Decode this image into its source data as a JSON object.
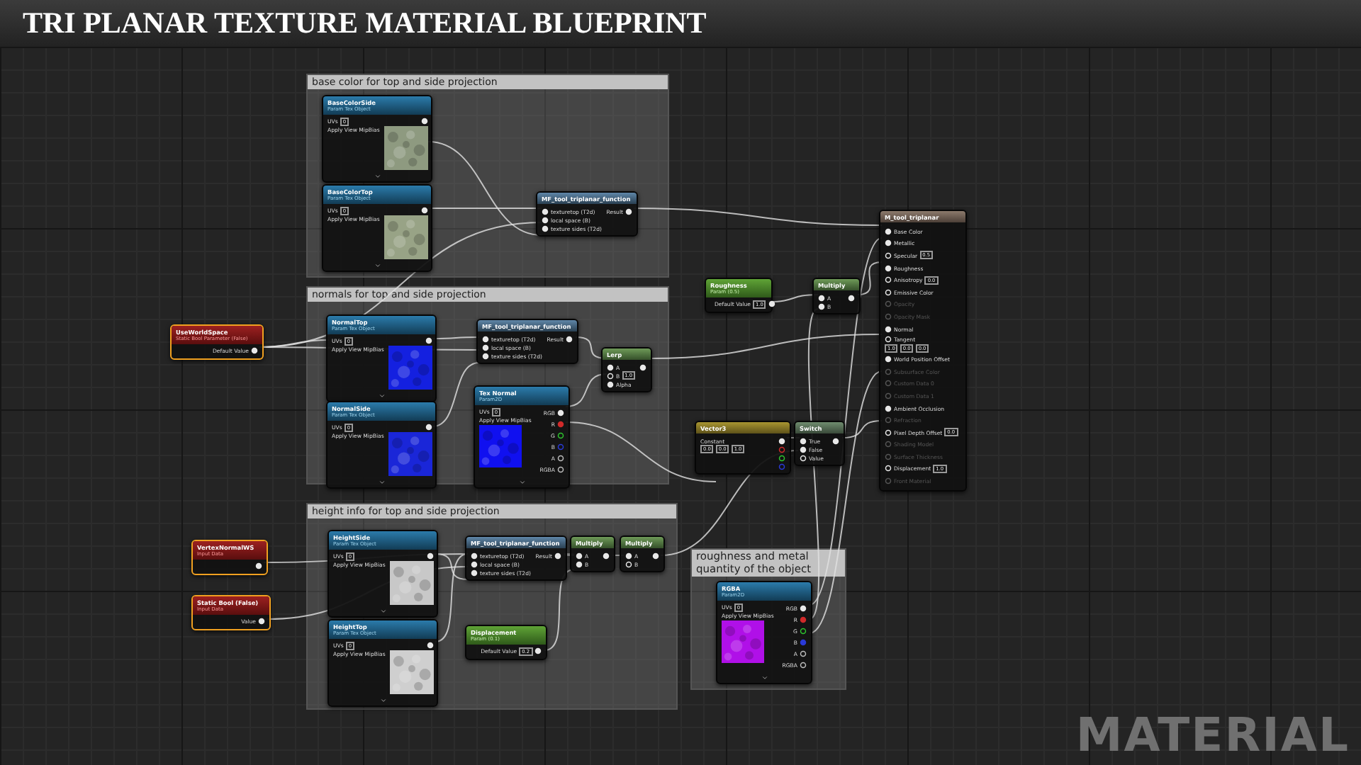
{
  "title": "TRI PLANAR TEXTURE MATERIAL BLUEPRINT",
  "comments": [
    {
      "text": "base color for top and side projection"
    },
    {
      "text": "normals for top and side projection"
    },
    {
      "text": "height info for top and side projection"
    },
    {
      "text": "roughness and metal quantity of the object"
    }
  ],
  "nodes": [
    {
      "kind": "texture_param",
      "title": "BaseColorSide",
      "subtitle": "Param Tex Object",
      "selected": false,
      "color": "#8e9a80",
      "fields": [
        {
          "label": "UVs",
          "value": "0"
        },
        {
          "label": "Apply View MipBias"
        }
      ],
      "outputs": [
        {
          "connected": true
        }
      ]
    },
    {
      "kind": "texture_param",
      "title": "BaseColorTop",
      "subtitle": "Param Tex Object",
      "selected": false,
      "color": "#98a386",
      "fields": [
        {
          "label": "UVs",
          "value": "0"
        },
        {
          "label": "Apply View MipBias"
        }
      ],
      "outputs": [
        {
          "connected": true
        }
      ]
    },
    {
      "kind": "function",
      "title": "MF_tool_triplanar_function",
      "selected": false,
      "inputs": [
        {
          "label": "texturetop (T2d)",
          "connected": true
        },
        {
          "label": "local space (B)",
          "connected": true
        },
        {
          "label": "texture sides (T2d)",
          "connected": true
        }
      ],
      "outputs": [
        {
          "label": "Result",
          "connected": true
        }
      ]
    },
    {
      "kind": "texture_param",
      "title": "NormalTop",
      "subtitle": "Param Tex Object",
      "selected": false,
      "color": "#1420e0",
      "fields": [
        {
          "label": "UVs",
          "value": "0"
        },
        {
          "label": "Apply View MipBias"
        }
      ],
      "outputs": [
        {
          "connected": true
        }
      ]
    },
    {
      "kind": "texture_param",
      "title": "NormalSide",
      "subtitle": "Param Tex Object",
      "selected": false,
      "color": "#1a26d8",
      "fields": [
        {
          "label": "UVs",
          "value": "0"
        },
        {
          "label": "Apply View MipBias"
        }
      ],
      "outputs": [
        {
          "connected": true
        }
      ]
    },
    {
      "kind": "bool_param",
      "title": "UseWorldSpace",
      "subtitle": "Static Bool Parameter (False)",
      "selected": true,
      "outputs": [
        {
          "label": "Default Value",
          "connected": true
        }
      ]
    },
    {
      "kind": "function",
      "title": "MF_tool_triplanar_function",
      "selected": false,
      "inputs": [
        {
          "label": "texturetop (T2d)",
          "connected": true
        },
        {
          "label": "local space (B)",
          "connected": true
        },
        {
          "label": "texture sides (T2d)",
          "connected": true
        }
      ],
      "outputs": [
        {
          "label": "Result",
          "connected": true
        }
      ]
    },
    {
      "kind": "texture_sample",
      "title": "Tex Normal",
      "subtitle": "Param2D",
      "selected": false,
      "color": "#1010f0",
      "fields": [
        {
          "label": "UVs",
          "value": "0"
        },
        {
          "label": "Apply View MipBias"
        }
      ],
      "outputs": [
        {
          "label": "RGB",
          "connected": true,
          "color": "#e8e8e8"
        },
        {
          "label": "R",
          "connected": true,
          "color": "#d02a2a"
        },
        {
          "label": "G",
          "connected": false,
          "color": "#2ec52e"
        },
        {
          "label": "B",
          "connected": false,
          "color": "#2a3ad8"
        },
        {
          "label": "A",
          "connected": false,
          "color": "#bdbdbd"
        },
        {
          "label": "RGBA",
          "connected": false,
          "color": "#bdbdbd"
        }
      ]
    },
    {
      "kind": "math",
      "title": "Lerp",
      "selected": false,
      "inputs": [
        {
          "label": "A",
          "connected": true
        },
        {
          "label": "B",
          "value": "1.0",
          "connected": false
        },
        {
          "label": "Alpha",
          "connected": true
        }
      ],
      "outputs": [
        {
          "connected": true
        }
      ]
    },
    {
      "kind": "scalar_param",
      "title": "Roughness",
      "subtitle": "Param (0.5)",
      "selected": false,
      "outputs": [
        {
          "label": "Default Value",
          "value": "1.0",
          "connected": true
        }
      ]
    },
    {
      "kind": "math",
      "title": "Multiply",
      "selected": false,
      "inputs": [
        {
          "label": "A",
          "connected": true
        },
        {
          "label": "B",
          "connected": true
        }
      ],
      "outputs": [
        {
          "connected": true
        }
      ]
    },
    {
      "kind": "constant3",
      "title": "Vector3",
      "selected": false,
      "fields": [
        {
          "label": "Constant"
        }
      ],
      "vector": [
        "0.0",
        "0.0",
        "1.0"
      ],
      "outputs": [
        {
          "connected": true,
          "color": "#e8e8e8"
        },
        {
          "connected": false,
          "color": "#d02a2a"
        },
        {
          "connected": false,
          "color": "#2ec52e"
        },
        {
          "connected": false,
          "color": "#2a3ad8"
        }
      ]
    },
    {
      "kind": "switch",
      "title": "Switch",
      "selected": false,
      "inputs": [
        {
          "label": "True",
          "connected": true
        },
        {
          "label": "False",
          "connected": true
        },
        {
          "label": "Value",
          "connected": false
        }
      ],
      "outputs": [
        {
          "connected": true
        }
      ]
    },
    {
      "kind": "result",
      "title": "M_tool_triplanar",
      "selected": false,
      "inputs": [
        {
          "label": "Base Color",
          "connected": true,
          "enabled": true
        },
        {
          "label": "Metallic",
          "connected": true,
          "enabled": true
        },
        {
          "label": "Specular",
          "value": "0.5",
          "connected": false,
          "enabled": true
        },
        {
          "label": "Roughness",
          "connected": true,
          "enabled": true
        },
        {
          "label": "Anisotropy",
          "value": "0.0",
          "connected": false,
          "enabled": true
        },
        {
          "label": "Emissive Color",
          "connected": false,
          "enabled": true
        },
        {
          "label": "Opacity",
          "connected": false,
          "enabled": false
        },
        {
          "label": "Opacity Mask",
          "connected": false,
          "enabled": false
        },
        {
          "label": "Normal",
          "connected": true,
          "enabled": true
        },
        {
          "label": "Tangent",
          "values": [
            "1.0",
            "0.0",
            "0.0"
          ],
          "connected": false,
          "enabled": true
        },
        {
          "label": "World Position Offset",
          "connected": true,
          "enabled": true
        },
        {
          "label": "Subsurface Color",
          "connected": false,
          "enabled": false
        },
        {
          "label": "Custom Data 0",
          "connected": false,
          "enabled": false
        },
        {
          "label": "Custom Data 1",
          "connected": false,
          "enabled": false
        },
        {
          "label": "Ambient Occlusion",
          "connected": true,
          "enabled": true
        },
        {
          "label": "Refraction",
          "connected": false,
          "enabled": false
        },
        {
          "label": "Pixel Depth Offset",
          "value": "0.0",
          "connected": false,
          "enabled": true
        },
        {
          "label": "Shading Model",
          "connected": false,
          "enabled": false
        },
        {
          "label": "Surface Thickness",
          "connected": false,
          "enabled": false
        },
        {
          "label": "Displacement",
          "value": "1.0",
          "connected": false,
          "enabled": true
        },
        {
          "label": "Front Material",
          "connected": false,
          "enabled": false
        }
      ]
    },
    {
      "kind": "input_data",
      "title": "VertexNormalWS",
      "subtitle": "Input Data",
      "selected": true,
      "outputs": [
        {
          "connected": true
        }
      ]
    },
    {
      "kind": "input_data",
      "title": "Static Bool (False)",
      "subtitle": "Input Data",
      "selected": true,
      "outputs": [
        {
          "label": "Value",
          "connected": true
        }
      ]
    },
    {
      "kind": "texture_param",
      "title": "HeightSide",
      "subtitle": "Param Tex Object",
      "selected": false,
      "color": "#c8c8c8",
      "fields": [
        {
          "label": "UVs",
          "value": "0"
        },
        {
          "label": "Apply View MipBias"
        }
      ],
      "outputs": [
        {
          "connected": true
        }
      ]
    },
    {
      "kind": "texture_param",
      "title": "HeightTop",
      "subtitle": "Param Tex Object",
      "selected": false,
      "color": "#cfcfcf",
      "fields": [
        {
          "label": "UVs",
          "value": "0"
        },
        {
          "label": "Apply View MipBias"
        }
      ],
      "outputs": [
        {
          "connected": true
        }
      ]
    },
    {
      "kind": "function",
      "title": "MF_tool_triplanar_function",
      "selected": false,
      "inputs": [
        {
          "label": "texturetop (T2d)",
          "connected": true
        },
        {
          "label": "local space (B)",
          "connected": true
        },
        {
          "label": "texture sides (T2d)",
          "connected": true
        }
      ],
      "outputs": [
        {
          "label": "Result",
          "connected": true
        }
      ]
    },
    {
      "kind": "math",
      "title": "Multiply",
      "selected": false,
      "inputs": [
        {
          "label": "A",
          "connected": true
        },
        {
          "label": "B",
          "connected": true
        }
      ],
      "outputs": [
        {
          "connected": true
        }
      ]
    },
    {
      "kind": "math",
      "title": "Multiply",
      "selected": false,
      "inputs": [
        {
          "label": "A",
          "connected": true
        },
        {
          "label": "B",
          "connected": false
        }
      ],
      "outputs": [
        {
          "connected": true
        }
      ]
    },
    {
      "kind": "scalar_param",
      "title": "Displacement",
      "subtitle": "Param (0.1)",
      "selected": false,
      "outputs": [
        {
          "label": "Default Value",
          "value": "0.2",
          "connected": true
        }
      ]
    },
    {
      "kind": "texture_sample",
      "title": "RGBA",
      "subtitle": "Param2D",
      "selected": false,
      "color": "#b010e8",
      "fields": [
        {
          "label": "UVs",
          "value": "0"
        },
        {
          "label": "Apply View MipBias"
        }
      ],
      "outputs": [
        {
          "label": "RGB",
          "connected": true,
          "color": "#e8e8e8"
        },
        {
          "label": "R",
          "connected": true,
          "color": "#d02a2a"
        },
        {
          "label": "G",
          "connected": false,
          "color": "#2ec52e"
        },
        {
          "label": "B",
          "connected": true,
          "color": "#2a3ad8"
        },
        {
          "label": "A",
          "connected": false,
          "color": "#bdbdbd"
        },
        {
          "label": "RGBA",
          "connected": false,
          "color": "#bdbdbd"
        }
      ]
    }
  ],
  "corner_label": "MATERIAL"
}
